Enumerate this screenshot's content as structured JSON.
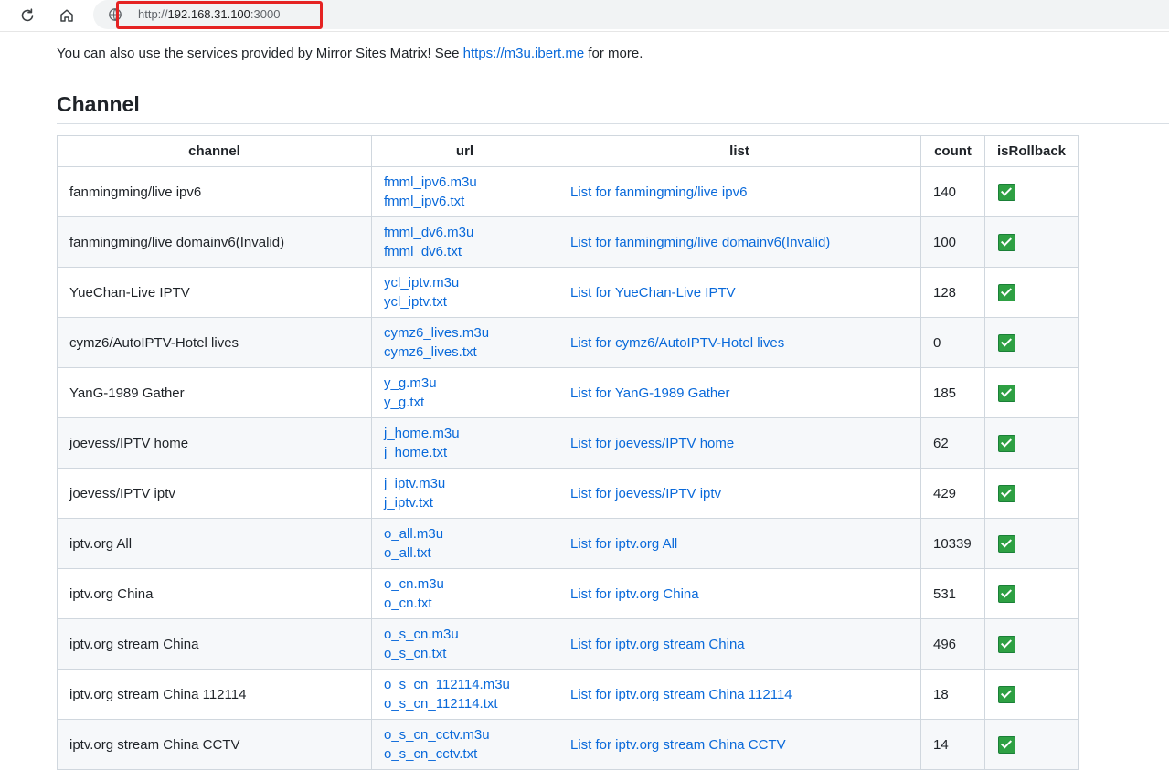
{
  "browser": {
    "url_scheme": "http://",
    "url_host": "192.168.31.100",
    "url_port": ":3000"
  },
  "intro": {
    "prefix": "You can also use the services provided by Mirror Sites Matrix! See ",
    "link_text": "https://m3u.ibert.me",
    "suffix": " for more."
  },
  "section": {
    "title": "Channel"
  },
  "table": {
    "headers": {
      "channel": "channel",
      "url": "url",
      "list": "list",
      "count": "count",
      "isRollback": "isRollback"
    },
    "rows": [
      {
        "channel": "fanmingming/live ipv6",
        "m3u": "fmml_ipv6.m3u",
        "txt": "fmml_ipv6.txt",
        "list": "List for fanmingming/live ipv6",
        "count": "140"
      },
      {
        "channel": "fanmingming/live domainv6(Invalid)",
        "m3u": "fmml_dv6.m3u",
        "txt": "fmml_dv6.txt",
        "list": "List for fanmingming/live domainv6(Invalid)",
        "count": "100"
      },
      {
        "channel": "YueChan-Live IPTV",
        "m3u": "ycl_iptv.m3u",
        "txt": "ycl_iptv.txt",
        "list": "List for YueChan-Live IPTV",
        "count": "128"
      },
      {
        "channel": "cymz6/AutoIPTV-Hotel lives",
        "m3u": "cymz6_lives.m3u",
        "txt": "cymz6_lives.txt",
        "list": "List for cymz6/AutoIPTV-Hotel lives",
        "count": "0"
      },
      {
        "channel": "YanG-1989 Gather",
        "m3u": "y_g.m3u",
        "txt": "y_g.txt",
        "list": "List for YanG-1989 Gather",
        "count": "185"
      },
      {
        "channel": "joevess/IPTV home",
        "m3u": "j_home.m3u",
        "txt": "j_home.txt",
        "list": "List for joevess/IPTV home",
        "count": "62"
      },
      {
        "channel": "joevess/IPTV iptv",
        "m3u": "j_iptv.m3u",
        "txt": "j_iptv.txt",
        "list": "List for joevess/IPTV iptv",
        "count": "429"
      },
      {
        "channel": "iptv.org All",
        "m3u": "o_all.m3u",
        "txt": "o_all.txt",
        "list": "List for iptv.org All",
        "count": "10339"
      },
      {
        "channel": "iptv.org China",
        "m3u": "o_cn.m3u",
        "txt": "o_cn.txt",
        "list": "List for iptv.org China",
        "count": "531"
      },
      {
        "channel": "iptv.org stream China",
        "m3u": "o_s_cn.m3u",
        "txt": "o_s_cn.txt",
        "list": "List for iptv.org stream China",
        "count": "496"
      },
      {
        "channel": "iptv.org stream China 112114",
        "m3u": "o_s_cn_112114.m3u",
        "txt": "o_s_cn_112114.txt",
        "list": "List for iptv.org stream China 112114",
        "count": "18"
      },
      {
        "channel": "iptv.org stream China CCTV",
        "m3u": "o_s_cn_cctv.m3u",
        "txt": "o_s_cn_cctv.txt",
        "list": "List for iptv.org stream China CCTV",
        "count": "14"
      }
    ]
  },
  "colors": {
    "link": "#0969da",
    "highlight_box": "#e52222",
    "check_green": "#2ea043"
  },
  "icons": {
    "reload": "reload-icon",
    "home": "home-icon",
    "site_info": "site-info-icon",
    "rollback": "checkmark-icon"
  }
}
